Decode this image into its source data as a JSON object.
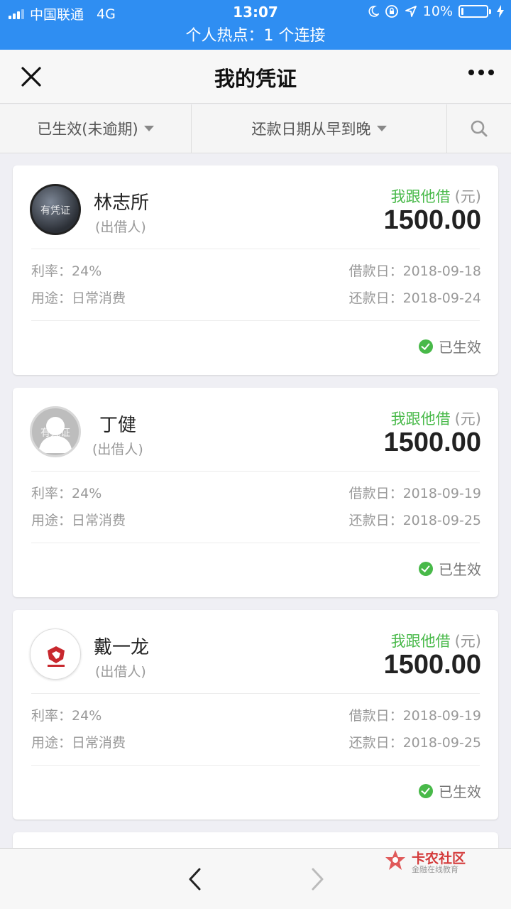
{
  "status_bar": {
    "carrier": "中国联通",
    "network": "4G",
    "time": "13:07",
    "battery": "10%",
    "battery_level": 0.1
  },
  "hotspot": "个人热点：1 个连接",
  "nav": {
    "title": "我的凭证"
  },
  "filters": {
    "status_label": "已生效(未逾期)",
    "sort_label": "还款日期从早到晚"
  },
  "labels": {
    "role": "(出借人)",
    "direction": "我跟他借",
    "unit": "(元)",
    "rate": "利率：",
    "use": "用途：",
    "lend_date": "借款日：",
    "repay_date": "还款日：",
    "status": "已生效",
    "avatar_overlay": "有凭证"
  },
  "cards": [
    {
      "name": "林志所",
      "amount": "1500.00",
      "rate": "24%",
      "use": "日常消费",
      "lend_date": "2018-09-18",
      "repay_date": "2018-09-24"
    },
    {
      "name": "丁健",
      "amount": "1500.00",
      "rate": "24%",
      "use": "日常消费",
      "lend_date": "2018-09-19",
      "repay_date": "2018-09-25"
    },
    {
      "name": "戴一龙",
      "amount": "1500.00",
      "rate": "24%",
      "use": "日常消费",
      "lend_date": "2018-09-19",
      "repay_date": "2018-09-25"
    }
  ],
  "watermark": {
    "title": "卡农社区",
    "subtitle": "金融在线教育"
  },
  "colors": {
    "status_bar": "#2f8ef2",
    "accent_green": "#48b949"
  }
}
